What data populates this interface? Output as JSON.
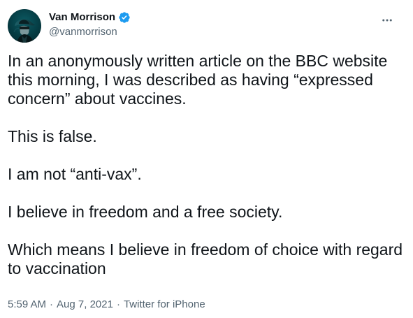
{
  "profile": {
    "display_name": "Van Morrison",
    "handle": "@vanmorrison",
    "avatar_icon": "person-in-hat-avatar-icon",
    "verified_icon": "verified-badge-icon"
  },
  "tweet": {
    "paragraphs": [
      "In an anonymously written article on the BBC website this morning, I was described as having “expressed concern” about vaccines.",
      "This is false.",
      "I am not “anti-vax”.",
      "I believe in freedom and a free society.",
      "Which means I believe in freedom of choice with regard to vaccination"
    ],
    "time": "5:59 AM",
    "date": "Aug 7, 2021",
    "source": "Twitter for iPhone",
    "more_icon": "more-options-icon"
  },
  "colors": {
    "text_primary": "#0f1419",
    "text_secondary": "#536471",
    "verified_blue": "#1d9bf0",
    "avatar_teal": "#053b42"
  }
}
